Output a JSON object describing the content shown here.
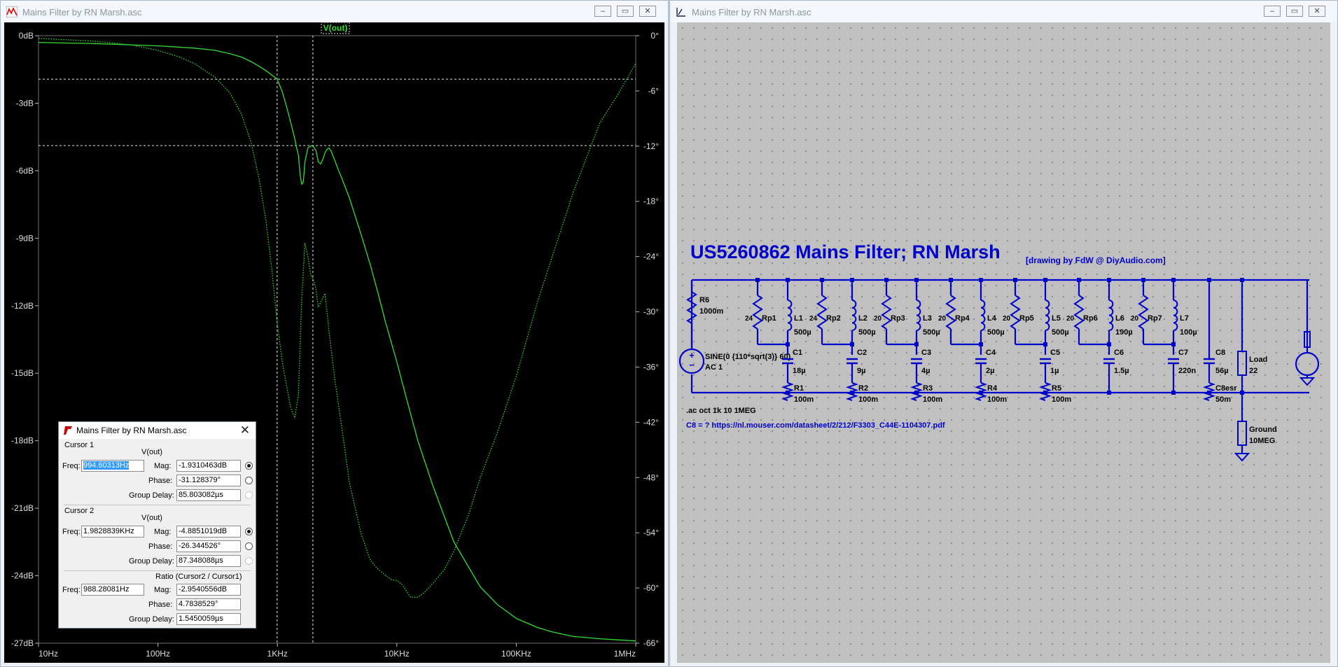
{
  "plot_window": {
    "title": "Mains Filter by RN Marsh.asc",
    "trace_label": "V(out)",
    "controls": {
      "minimize": "–",
      "restore": "▭",
      "close": "✕"
    }
  },
  "schematic_window": {
    "title": "Mains Filter by RN Marsh.asc",
    "controls": {
      "minimize": "–",
      "restore": "▭",
      "close": "✕"
    }
  },
  "chart_data": {
    "type": "line",
    "x_scale": "log",
    "xlim": [
      10,
      1000000
    ],
    "x_ticks": [
      "10Hz",
      "100Hz",
      "1KHz",
      "10KHz",
      "100KHz",
      "1MHz"
    ],
    "ylim_left": [
      -27,
      0
    ],
    "y_ticks_left": [
      "0dB",
      "-3dB",
      "-6dB",
      "-9dB",
      "-12dB",
      "-15dB",
      "-18dB",
      "-21dB",
      "-24dB",
      "-27dB"
    ],
    "ylim_right": [
      -66,
      0
    ],
    "y_ticks_right": [
      "0°",
      "-6°",
      "-12°",
      "-18°",
      "-24°",
      "-30°",
      "-36°",
      "-42°",
      "-48°",
      "-54°",
      "-60°",
      "-66°"
    ],
    "grid": false,
    "background": "#000000",
    "trace_color": "#33dd33",
    "series": [
      {
        "name": "V(out)",
        "style": "solid",
        "axis": "left",
        "x": [
          10,
          30,
          100,
          200,
          300,
          400,
          500,
          600,
          700,
          800,
          900,
          994.6,
          1100,
          1200,
          1300,
          1400,
          1450,
          1500,
          1550,
          1600,
          1650,
          1700,
          1800,
          1900,
          1983,
          2100,
          2200,
          2300,
          2400,
          2500,
          2600,
          2700,
          2800,
          3000,
          3200,
          3500,
          4000,
          5000,
          6000,
          7000,
          8000,
          10000,
          12000,
          15000,
          20000,
          30000,
          50000,
          70000,
          100000,
          150000,
          200000,
          300000,
          500000,
          700000,
          1000000
        ],
        "y": [
          -0.3,
          -0.35,
          -0.45,
          -0.55,
          -0.65,
          -0.8,
          -0.95,
          -1.15,
          -1.35,
          -1.55,
          -1.75,
          -1.93,
          -2.5,
          -3.2,
          -3.9,
          -4.6,
          -5.0,
          -5.3,
          -6.2,
          -6.6,
          -6.5,
          -5.6,
          -5.0,
          -4.9,
          -4.89,
          -5.1,
          -5.6,
          -5.7,
          -5.5,
          -5.2,
          -5.05,
          -5.0,
          -5.1,
          -5.5,
          -5.9,
          -6.4,
          -7.2,
          -8.8,
          -10.2,
          -11.5,
          -12.7,
          -14.5,
          -16.1,
          -18.0,
          -20.0,
          -22.5,
          -24.5,
          -25.3,
          -25.9,
          -26.3,
          -26.5,
          -26.7,
          -26.8,
          -26.85,
          -26.9
        ]
      },
      {
        "name": "V(out) phase",
        "style": "dotted",
        "axis": "right",
        "x": [
          10,
          30,
          60,
          100,
          150,
          200,
          300,
          400,
          500,
          600,
          700,
          800,
          900,
          994.6,
          1100,
          1200,
          1300,
          1400,
          1500,
          1600,
          1700,
          1800,
          1900,
          1983,
          2100,
          2200,
          2300,
          2500,
          2700,
          3000,
          3500,
          4000,
          5000,
          6000,
          7000,
          8000,
          9000,
          10000,
          11000,
          12000,
          13000,
          15000,
          17000,
          20000,
          25000,
          30000,
          40000,
          50000,
          70000,
          100000,
          150000,
          200000,
          300000,
          500000,
          700000,
          1000000
        ],
        "y": [
          -0.3,
          -0.6,
          -1.0,
          -1.6,
          -2.3,
          -3.0,
          -4.5,
          -6.2,
          -8.5,
          -11.5,
          -15.5,
          -20.0,
          -25.5,
          -31.13,
          -35.5,
          -38.2,
          -40.5,
          -41.5,
          -39.0,
          -28.5,
          -22.5,
          -24.0,
          -26.0,
          -26.34,
          -27.5,
          -29.5,
          -29.0,
          -28.0,
          -32.0,
          -37.0,
          -43.0,
          -48.5,
          -54.0,
          -57.0,
          -58.0,
          -58.6,
          -59.1,
          -59.2,
          -59.6,
          -60.3,
          -61.0,
          -61.0,
          -60.5,
          -59.5,
          -58.0,
          -56.0,
          -52.0,
          -48.0,
          -43.0,
          -37.0,
          -29.0,
          -24.0,
          -17.0,
          -9.5,
          -6.5,
          -3.0
        ]
      }
    ],
    "cursors": [
      {
        "name": "Cursor 1",
        "freq": 994.60313,
        "mag_db": -1.9310463,
        "phase_deg": -31.128379,
        "style": "dashed"
      },
      {
        "name": "Cursor 2",
        "freq": 1982.8839,
        "mag_db": -4.8851019,
        "phase_deg": -26.344526,
        "style": "dashed"
      }
    ]
  },
  "cursor_dialog": {
    "title": "Mains Filter by RN Marsh.asc",
    "close": "✕",
    "cursor1": {
      "group_label": "Cursor 1",
      "trace": "V(out)",
      "freq_label": "Freq:",
      "freq": "994.60313Hz",
      "mag_label": "Mag:",
      "mag": "-1.9310463dB",
      "phase_label": "Phase:",
      "phase": "-31.128379°",
      "gd_label": "Group Delay:",
      "gd": "85.803082µs"
    },
    "cursor2": {
      "group_label": "Cursor 2",
      "trace": "V(out)",
      "freq_label": "Freq:",
      "freq": "1.9828839KHz",
      "mag_label": "Mag:",
      "mag": "-4.8851019dB",
      "phase_label": "Phase:",
      "phase": "-26.344526°",
      "gd_label": "Group Delay:",
      "gd": "87.348088µs"
    },
    "ratio": {
      "group_label": "Ratio (Cursor2 / Cursor1)",
      "freq_label": "Freq:",
      "freq": "988.28081Hz",
      "mag_label": "Mag:",
      "mag": "-2.9540556dB",
      "phase_label": "Phase:",
      "phase": "4.7838529°",
      "gd_label": "Group Delay:",
      "gd": "1.5450059µs"
    }
  },
  "schematic": {
    "title": "US5260862 Mains Filter; RN Marsh",
    "credit": "[drawing by FdW @ DiyAudio.com]",
    "directive": ".ac oct 1k 10 1MEG",
    "comment": "C8 = ? https://nl.mouser.com/datasheet/2/212/F3303_C44E-1104307.pdf",
    "wire_color": "#0000cc",
    "source": {
      "name": "R6",
      "value": "1000m",
      "spec": "SINE(0 {110*sqrt(3)} 60)",
      "ac": "AC 1"
    },
    "sections": [
      {
        "rp": "Rp1",
        "rp_val": "24",
        "l": "L1",
        "l_val": "500µ",
        "c": "C1",
        "c_val": "18µ",
        "r": "R1",
        "r_val": "100m"
      },
      {
        "rp": "Rp2",
        "rp_val": "24",
        "l": "L2",
        "l_val": "500µ",
        "c": "C2",
        "c_val": "9µ",
        "r": "R2",
        "r_val": "100m"
      },
      {
        "rp": "Rp3",
        "rp_val": "20",
        "l": "L3",
        "l_val": "500µ",
        "c": "C3",
        "c_val": "4µ",
        "r": "R3",
        "r_val": "100m"
      },
      {
        "rp": "Rp4",
        "rp_val": "20",
        "l": "L4",
        "l_val": "500µ",
        "c": "C4",
        "c_val": "2µ",
        "r": "R4",
        "r_val": "100m"
      },
      {
        "rp": "Rp5",
        "rp_val": "20",
        "l": "L5",
        "l_val": "500µ",
        "c": "C5",
        "c_val": "1µ",
        "r": "R5",
        "r_val": "100m"
      },
      {
        "rp": "Rp6",
        "rp_val": "20",
        "l": "L6",
        "l_val": "190µ",
        "c": "C6",
        "c_val": "1.5µ",
        "r": "",
        "r_val": ""
      },
      {
        "rp": "Rp7",
        "rp_val": "20",
        "l": "L7",
        "l_val": "100µ",
        "c": "C7",
        "c_val": "220n",
        "r": "",
        "r_val": ""
      }
    ],
    "c8": {
      "name": "C8",
      "value": "56µ",
      "esr_name": "C8esr",
      "esr_value": "50m"
    },
    "load": {
      "name": "Load",
      "value": "22"
    },
    "ground": {
      "name": "Ground",
      "value": "10MEG"
    }
  }
}
